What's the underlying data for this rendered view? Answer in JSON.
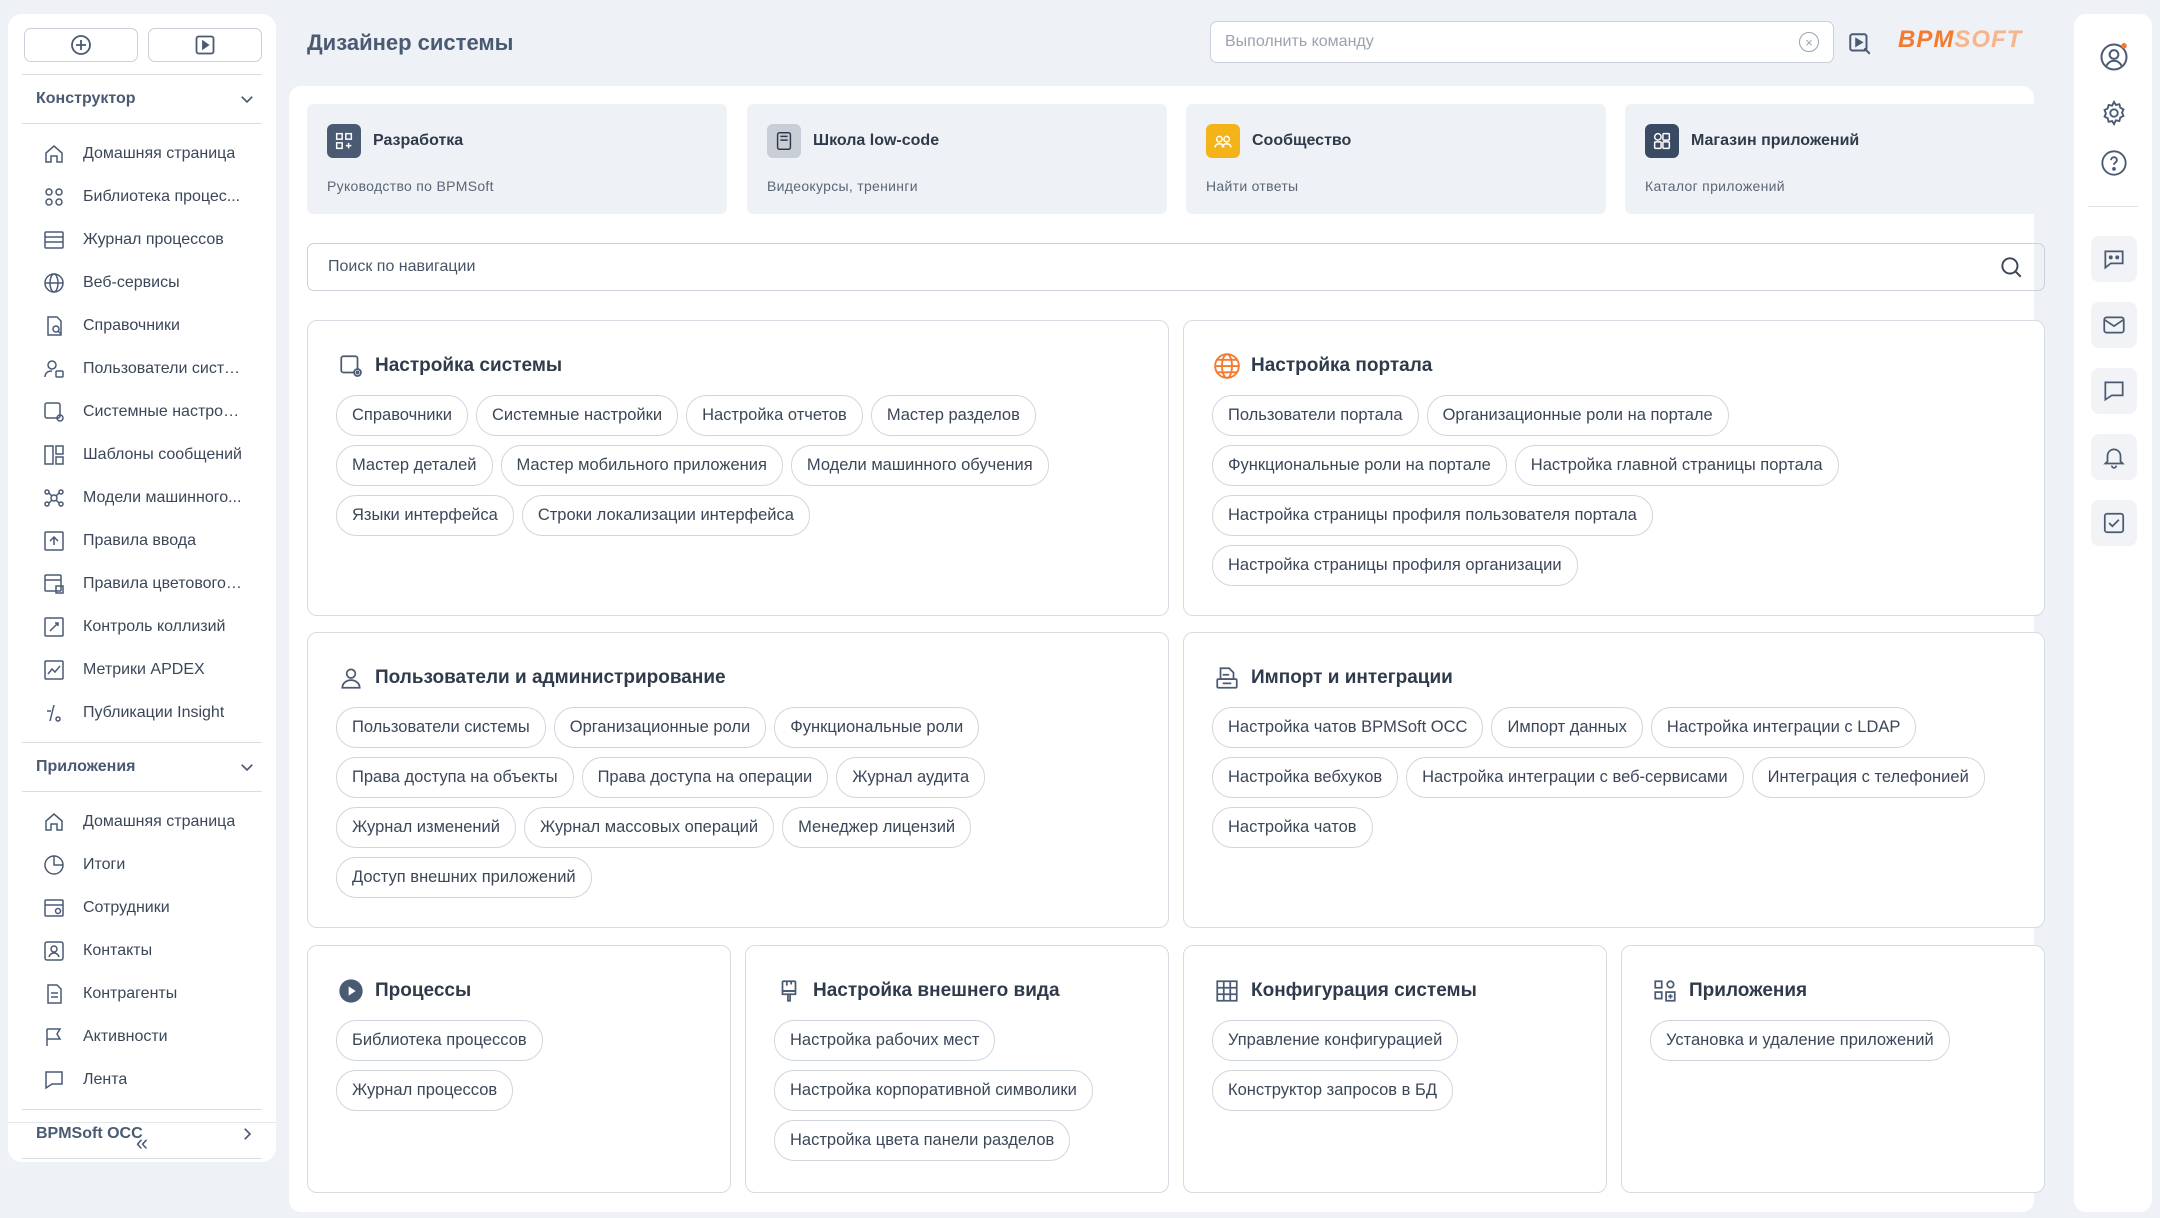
{
  "header": {
    "title": "Дизайнер системы",
    "command_placeholder": "Выполнить команду",
    "logo_main": "BPM",
    "logo_accent": "SOFT"
  },
  "sidebar": {
    "sections": [
      {
        "title": "Конструктор",
        "items": [
          {
            "label": "Домашняя страница",
            "icon": "home-icon"
          },
          {
            "label": "Библиотека процес...",
            "icon": "process-library-icon"
          },
          {
            "label": "Журнал процессов",
            "icon": "process-log-icon"
          },
          {
            "label": "Веб-сервисы",
            "icon": "globe-icon"
          },
          {
            "label": "Справочники",
            "icon": "lookup-icon"
          },
          {
            "label": "Пользователи систе...",
            "icon": "system-users-icon"
          },
          {
            "label": "Системные настрой...",
            "icon": "system-settings-icon"
          },
          {
            "label": "Шаблоны сообщений",
            "icon": "templates-icon"
          },
          {
            "label": "Модели машинного...",
            "icon": "ml-models-icon"
          },
          {
            "label": "Правила ввода",
            "icon": "input-rules-icon"
          },
          {
            "label": "Правила цветового ...",
            "icon": "color-rules-icon"
          },
          {
            "label": "Контроль коллизий",
            "icon": "collision-icon"
          },
          {
            "label": "Метрики APDEX",
            "icon": "metrics-icon"
          },
          {
            "label": "Публикации Insight",
            "icon": "insight-icon"
          }
        ]
      },
      {
        "title": "Приложения",
        "items": [
          {
            "label": "Домашняя страница",
            "icon": "home-icon"
          },
          {
            "label": "Итоги",
            "icon": "pie-chart-icon"
          },
          {
            "label": "Сотрудники",
            "icon": "employees-icon"
          },
          {
            "label": "Контакты",
            "icon": "contacts-icon"
          },
          {
            "label": "Контрагенты",
            "icon": "accounts-icon"
          },
          {
            "label": "Активности",
            "icon": "flag-icon"
          },
          {
            "label": "Лента",
            "icon": "feed-icon"
          }
        ]
      }
    ],
    "collapsed_section": "BPMSoft OCC"
  },
  "quick_links": [
    {
      "title": "Разработка",
      "subtitle": "Руководство по BPMSoft",
      "icon": "development-icon",
      "color": "#4a5a73"
    },
    {
      "title": "Школа low-code",
      "subtitle": "Видеокурсы, тренинги",
      "icon": "school-icon",
      "color": "#c9ced6"
    },
    {
      "title": "Сообщество",
      "subtitle": "Найти ответы",
      "icon": "community-icon",
      "color": "#f5b31a"
    },
    {
      "title": "Магазин приложений",
      "subtitle": "Каталог приложений",
      "icon": "app-store-icon",
      "color": "#3a4a63"
    }
  ],
  "nav_search_placeholder": "Поиск по навигации",
  "cards": [
    {
      "title": "Настройка системы",
      "icon": "system-setup-icon",
      "chips": [
        "Справочники",
        "Системные настройки",
        "Настройка отчетов",
        "Мастер разделов",
        "Мастер деталей",
        "Мастер мобильного приложения",
        "Модели машинного обучения",
        "Языки интерфейса",
        "Строки локализации интерфейса"
      ]
    },
    {
      "title": "Настройка портала",
      "icon": "portal-globe-icon",
      "chips": [
        "Пользователи портала",
        "Организационные роли на портале",
        "Функциональные роли на портале",
        "Настройка главной страницы портала",
        "Настройка страницы профиля пользователя портала",
        "Настройка страницы профиля организации"
      ]
    },
    {
      "title": "Пользователи и администрирование",
      "icon": "user-icon",
      "chips": [
        "Пользователи системы",
        "Организационные роли",
        "Функциональные роли",
        "Права доступа на объекты",
        "Права доступа на операции",
        "Журнал аудита",
        "Журнал изменений",
        "Журнал массовых операций",
        "Менеджер лицензий",
        "Доступ внешних приложений"
      ]
    },
    {
      "title": "Импорт и интеграции",
      "icon": "import-icon",
      "chips": [
        "Настройка чатов BPMSoft OCC",
        "Импорт данных",
        "Настройка интеграции с LDAP",
        "Настройка вебхуков",
        "Настройка интеграции с веб-сервисами",
        "Интеграция с телефонией",
        "Настройка чатов"
      ]
    },
    {
      "title": "Процессы",
      "icon": "play-circle-icon",
      "chips": [
        "Библиотека процессов",
        "Журнал процессов"
      ]
    },
    {
      "title": "Настройка внешнего вида",
      "icon": "brush-icon",
      "chips": [
        "Настройка рабочих мест",
        "Настройка корпоративной символики",
        "Настройка цвета панели разделов"
      ]
    },
    {
      "title": "Конфигурация системы",
      "icon": "grid-icon",
      "chips": [
        "Управление конфигурацией",
        "Конструктор запросов в БД"
      ]
    },
    {
      "title": "Приложения",
      "icon": "apps-icon",
      "chips": [
        "Установка и удаление приложений"
      ]
    }
  ],
  "colors": {
    "accent": "#f47a30",
    "text": "#2f3a4a",
    "muted": "#4a5a73"
  }
}
